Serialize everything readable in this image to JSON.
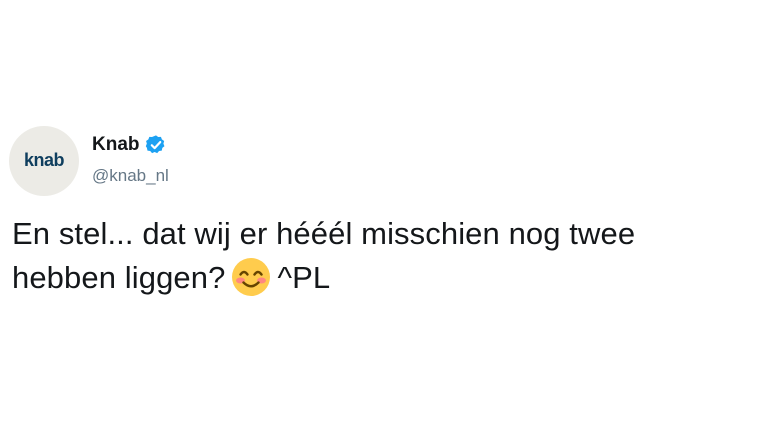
{
  "author": {
    "avatar_text": "knab",
    "display_name": "Knab",
    "handle": "@knab_nl",
    "verified_icon": "verified-badge-icon"
  },
  "tweet": {
    "line1": "En stel... dat wij er hééél misschien nog twee",
    "line2_before": "hebben liggen?",
    "emoji": "smiling-face-with-smiling-eyes-icon",
    "line2_after": "^PL"
  },
  "colors": {
    "text": "#14171a",
    "secondary": "#657786",
    "verified": "#1da1f2",
    "avatar_bg": "#ecebe6",
    "logo": "#0f3e5e"
  }
}
